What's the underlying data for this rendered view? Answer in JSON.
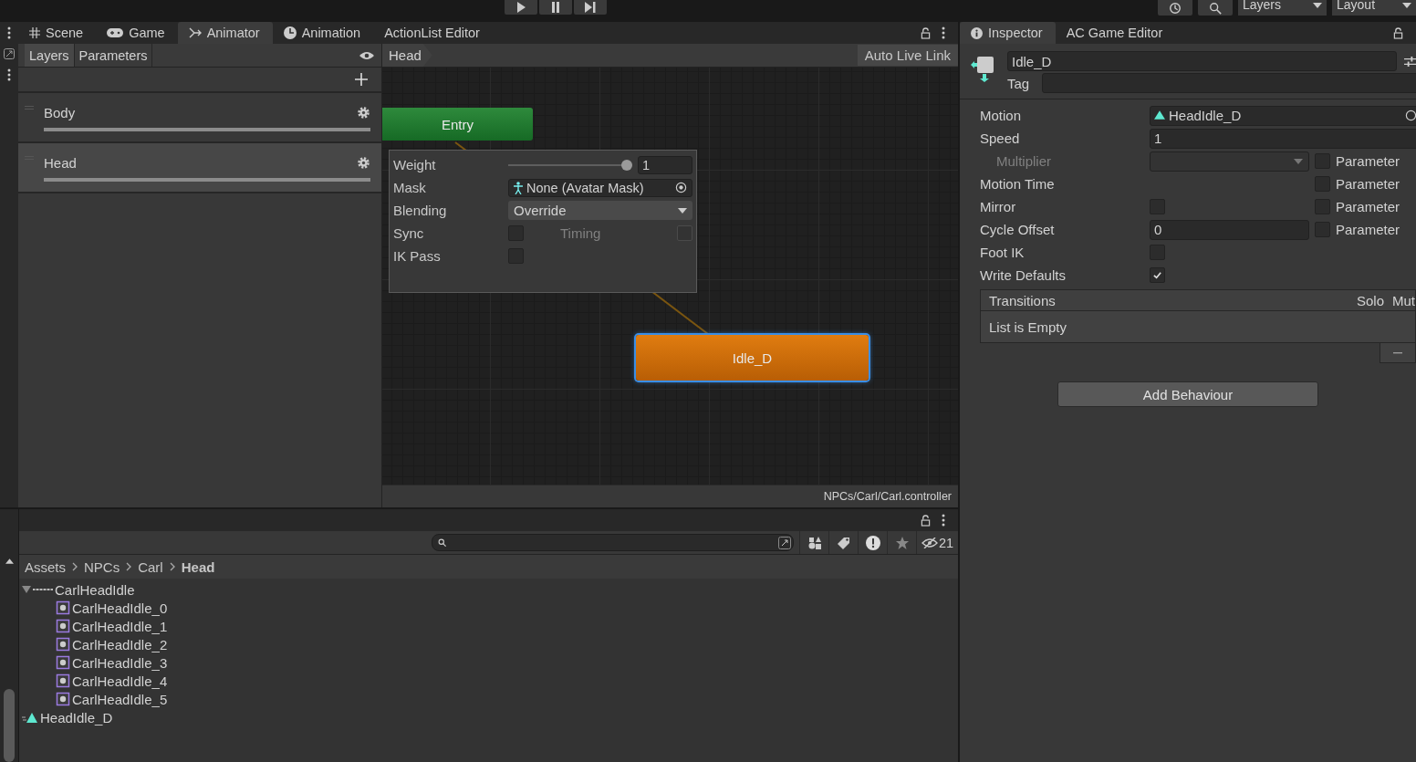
{
  "toolbar": {
    "dropdowns": [
      {
        "label": "Layers"
      },
      {
        "label": "Layout"
      }
    ]
  },
  "window_tabs": [
    {
      "label": "Scene",
      "kind": "scene",
      "selected": false
    },
    {
      "label": "Game",
      "kind": "game",
      "selected": false
    },
    {
      "label": "Animator",
      "kind": "animator",
      "selected": true
    },
    {
      "label": "Animation",
      "kind": "animation",
      "selected": false
    },
    {
      "label": "ActionList Editor",
      "kind": "plain",
      "selected": false
    }
  ],
  "layers_panel": {
    "tabs": [
      {
        "label": "Layers",
        "selected": true
      },
      {
        "label": "Parameters",
        "selected": false
      }
    ],
    "layers": [
      {
        "name": "Body",
        "selected": false,
        "level": 1
      },
      {
        "name": "Head",
        "selected": true,
        "level": 1
      }
    ]
  },
  "graph": {
    "breadcrumb": "Head",
    "live_link_button": "Auto Live Link",
    "nodes": [
      {
        "label": "Entry",
        "kind": "entry",
        "selected": false
      },
      {
        "label": "Idle_D",
        "kind": "state",
        "selected": true
      }
    ],
    "status": "NPCs/Carl/Carl.controller"
  },
  "layer_settings": {
    "weight": {
      "label": "Weight",
      "level": 1,
      "value": "1"
    },
    "mask": {
      "label": "Mask",
      "value": "None (Avatar Mask)"
    },
    "blending": {
      "label": "Blending",
      "value": "Override"
    },
    "sync": {
      "label": "Sync",
      "checked": false
    },
    "timing": {
      "label": "Timing",
      "checked": false,
      "disabled": true
    },
    "ik_pass": {
      "label": "IK Pass",
      "checked": false
    }
  },
  "project": {
    "filter_count": "21",
    "breadcrumb": [
      {
        "label": "Assets",
        "current": false
      },
      {
        "label": "NPCs",
        "current": false
      },
      {
        "label": "Carl",
        "current": false
      },
      {
        "label": "Head",
        "current": true
      }
    ],
    "tree": [
      {
        "name": "CarlHeadIdle",
        "kind": "sheet",
        "expanded": true,
        "children": [
          {
            "name": "CarlHeadIdle_0",
            "kind": "sprite"
          },
          {
            "name": "CarlHeadIdle_1",
            "kind": "sprite"
          },
          {
            "name": "CarlHeadIdle_2",
            "kind": "sprite"
          },
          {
            "name": "CarlHeadIdle_3",
            "kind": "sprite"
          },
          {
            "name": "CarlHeadIdle_4",
            "kind": "sprite"
          },
          {
            "name": "CarlHeadIdle_5",
            "kind": "sprite"
          }
        ]
      },
      {
        "name": "HeadIdle_D",
        "kind": "clip"
      }
    ]
  },
  "inspector": {
    "tabs": [
      {
        "label": "Inspector",
        "selected": true
      },
      {
        "label": "AC Game Editor",
        "selected": false
      }
    ],
    "name": "Idle_D",
    "tag_label": "Tag",
    "properties": [
      {
        "label": "Motion",
        "kind": "object",
        "value": "HeadIdle_D",
        "disabled": false
      },
      {
        "label": "Speed",
        "kind": "number",
        "value": "1",
        "disabled": false
      },
      {
        "label": "Multiplier",
        "kind": "dropdown",
        "disabled": true,
        "parameter": {
          "label": "Parameter",
          "checked": false
        }
      },
      {
        "label": "Motion Time",
        "kind": "empty",
        "disabled": false,
        "parameter": {
          "label": "Parameter",
          "checked": false
        }
      },
      {
        "label": "Mirror",
        "kind": "checkbox",
        "checked": false,
        "disabled": false,
        "parameter": {
          "label": "Parameter",
          "checked": false
        }
      },
      {
        "label": "Cycle Offset",
        "kind": "short_number",
        "value": "0",
        "disabled": false,
        "parameter": {
          "label": "Parameter",
          "checked": false
        }
      },
      {
        "label": "Foot IK",
        "kind": "checkbox",
        "checked": false,
        "disabled": false
      },
      {
        "label": "Write Defaults",
        "kind": "checkbox",
        "checked": true,
        "disabled": false
      }
    ],
    "transitions": {
      "title": "Transitions",
      "solo": "Solo",
      "mute": "Mut",
      "empty": "List is Empty"
    },
    "add_button": "Add Behaviour"
  }
}
